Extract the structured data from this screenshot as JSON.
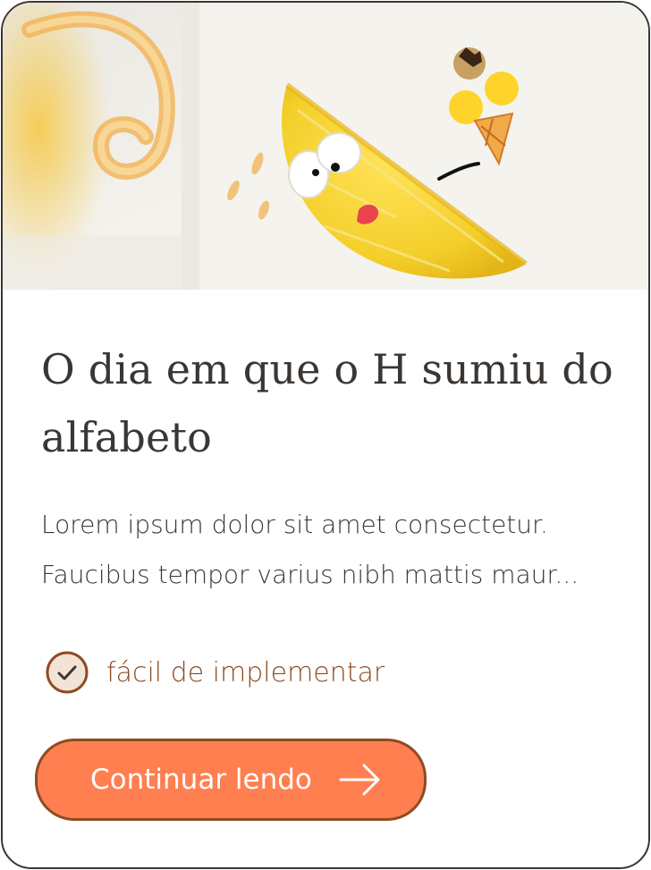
{
  "card": {
    "image_alt": "Caneca de cerâmica com uma fatia de limão sorridente e um sorvete de casquinha",
    "title": "O dia em que o H sumiu do alfabeto",
    "excerpt": "Lorem ipsum dolor sit amet consectetur. Faucibus tempor varius nibh mattis maur...",
    "badge": {
      "icon": "check-circle-icon",
      "label": "fácil de implementar"
    },
    "cta": {
      "label": "Continuar lendo",
      "icon": "arrow-right-icon"
    }
  },
  "colors": {
    "border": "#3a3633",
    "text": "#3a3633",
    "accent_brown": "#8f4b21",
    "button_fill": "#ff7f50",
    "badge_fill": "#f3e3d7"
  }
}
